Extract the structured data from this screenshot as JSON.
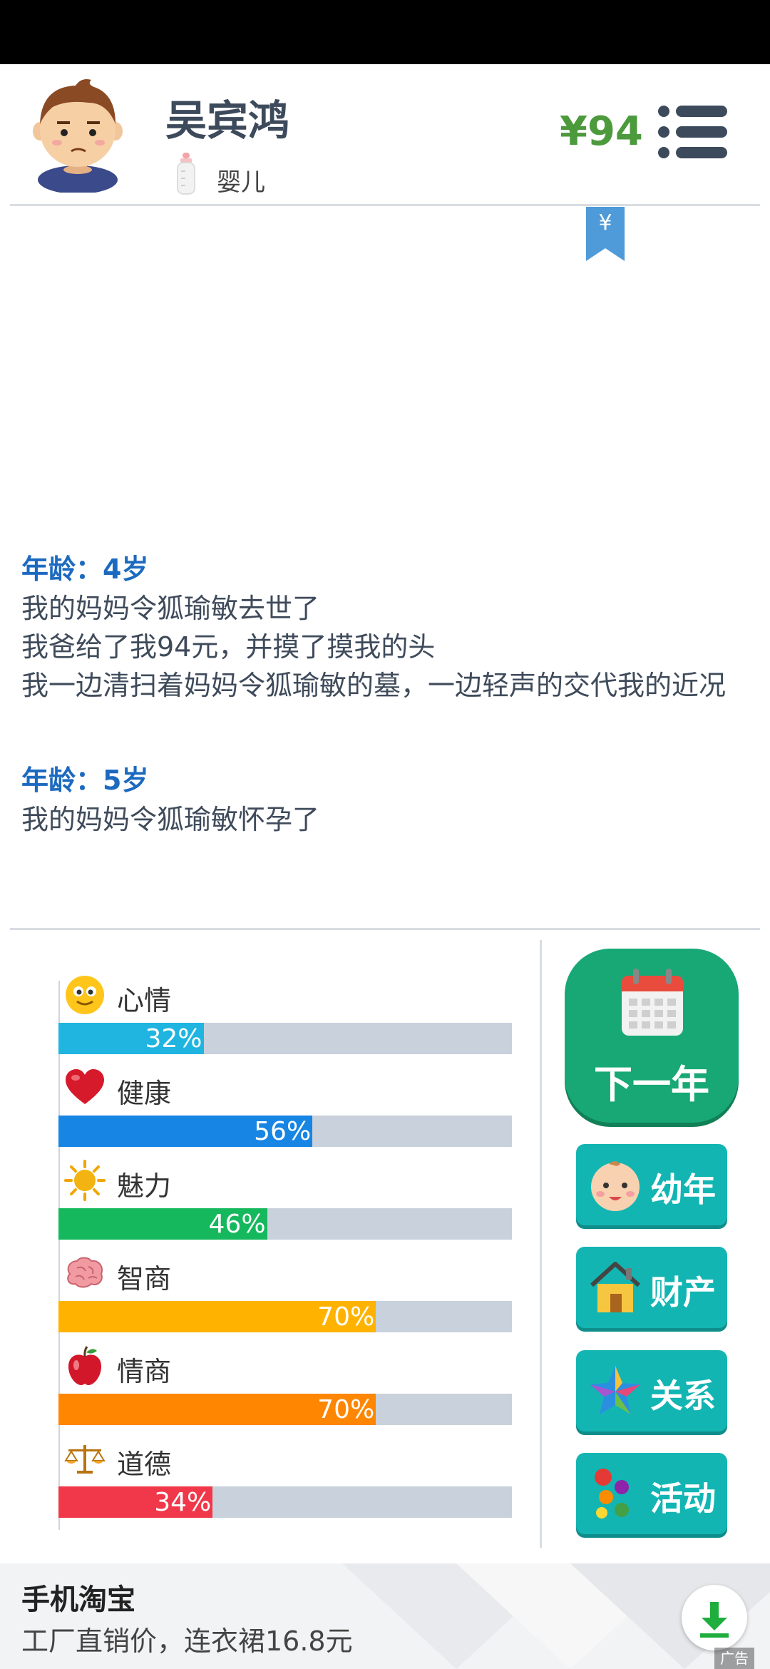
{
  "header": {
    "player_name": "吴宾鸿",
    "life_stage": "婴儿",
    "money": "¥94"
  },
  "bookmark": {
    "symbol": "¥"
  },
  "log": [
    {
      "age": "年龄：4岁",
      "lines": [
        "我的妈妈令狐瑜敏去世了",
        "我爸给了我94元，并摸了摸我的头",
        "我一边清扫着妈妈令狐瑜敏的墓，一边轻声的交代我的近况"
      ]
    },
    {
      "age": "年龄：5岁",
      "lines": [
        "我的妈妈令狐瑜敏怀孕了"
      ]
    }
  ],
  "stats": [
    {
      "name": "心情",
      "icon": "smile-face-icon",
      "value": 32,
      "label": "32%",
      "color": "#1fb5e0"
    },
    {
      "name": "健康",
      "icon": "heart-icon",
      "value": 56,
      "label": "56%",
      "color": "#1685e3"
    },
    {
      "name": "魅力",
      "icon": "sun-icon",
      "value": 46,
      "label": "46%",
      "color": "#16b85e"
    },
    {
      "name": "智商",
      "icon": "brain-icon",
      "value": 70,
      "label": "70%",
      "color": "#ffb300"
    },
    {
      "name": "情商",
      "icon": "apple-icon",
      "value": 70,
      "label": "70%",
      "color": "#ff8600"
    },
    {
      "name": "道德",
      "icon": "scale-icon",
      "value": 34,
      "label": "34%",
      "color": "#f0384a"
    }
  ],
  "actions": {
    "next_year": "下一年",
    "childhood": "幼年",
    "property": "财产",
    "relations": "关系",
    "activity": "活动"
  },
  "ad": {
    "title": "手机淘宝",
    "description": "工厂直销价，连衣裙16.8元",
    "badge": "广告"
  },
  "colors": {
    "accent_green": "#18a876",
    "teal_button": "#13b5b3",
    "money_green": "#4c9a3c",
    "age_blue": "#1c6ac0"
  }
}
